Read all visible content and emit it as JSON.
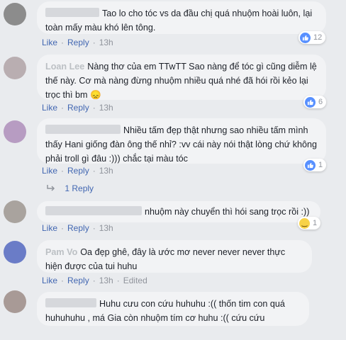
{
  "comments": [
    {
      "text": "Tao lo cho tóc vs da đầu chị quá nhuộm hoài luôn, lại toàn mấy màu khó lên tông.",
      "reaction": {
        "type": "like",
        "count": "12"
      },
      "actions": {
        "like": "Like",
        "reply": "Reply",
        "time": "13h"
      }
    },
    {
      "name": "Loan Lee",
      "text": "Nàng thơ của em TTwTT Sao nàng để tóc gì cũng diễm lệ thế này. Cơ mà nàng đừng nhuộm nhiều quá nhé đã hói rồi kẻo lại trọc thì bm 😞",
      "reaction": {
        "type": "like",
        "count": "6"
      },
      "actions": {
        "like": "Like",
        "reply": "Reply",
        "time": "13h"
      }
    },
    {
      "text": "Nhiều tấm đẹp thật nhưng sao nhiều tấm mình thấy Hani giống đàn ông thế nhỉ? :vv cái này nói thật lòng chứ không phải troll gì đâu :))) chắc tại màu tóc",
      "reaction": {
        "type": "like",
        "count": "1"
      },
      "actions": {
        "like": "Like",
        "reply": "Reply",
        "time": "13h"
      },
      "replies_link": "1 Reply"
    },
    {
      "text": "nhuộm này chuyển thì hói sang trọc rồi :))",
      "reaction": {
        "type": "haha",
        "count": "1"
      },
      "actions": {
        "like": "Like",
        "reply": "Reply",
        "time": "13h"
      }
    },
    {
      "name": "Pam Vo",
      "text": "Oa đẹp ghê, đây là ước mơ never never never thực hiện được của tui huhu",
      "actions": {
        "like": "Like",
        "reply": "Reply",
        "time": "13h",
        "edited": "Edited"
      }
    },
    {
      "text": "Huhu cưu con cứu huhuhu :(( thốn tim con quá huhuhuhu , má Gia còn nhuộm tím cơ huhu :(( cứu cứu"
    }
  ],
  "colors": {
    "background": "#e9ebee",
    "bubble": "#f2f3f5",
    "link": "#4267b2",
    "meta": "#90949c",
    "like": "#5890ff"
  }
}
